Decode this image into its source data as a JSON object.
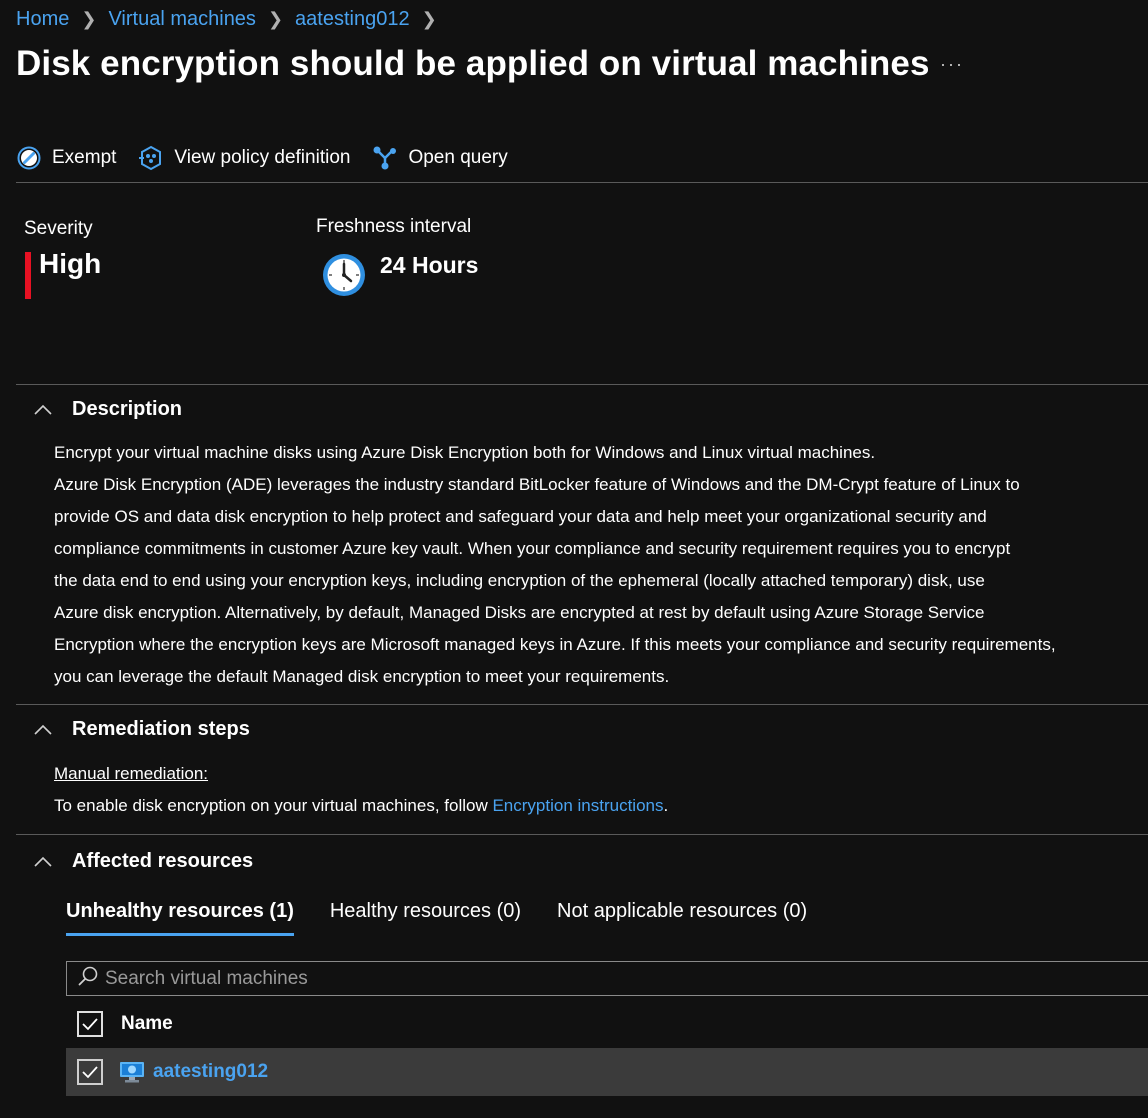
{
  "breadcrumb": {
    "items": [
      "Home",
      "Virtual machines",
      "aatesting012"
    ]
  },
  "page": {
    "title": "Disk encryption should be applied on virtual machines",
    "more_glyph": "···"
  },
  "toolbar": {
    "exempt": "Exempt",
    "view_policy": "View policy definition",
    "open_query": "Open query"
  },
  "summary": {
    "severity_label": "Severity",
    "severity_value": "High",
    "severity_color": "#e81123",
    "freshness_label": "Freshness interval",
    "freshness_value": "24 Hours"
  },
  "description": {
    "heading": "Description",
    "lines": [
      "Encrypt your virtual machine disks using Azure Disk Encryption both for Windows and Linux virtual machines.",
      "Azure Disk Encryption (ADE) leverages the industry standard BitLocker feature of Windows and the DM-Crypt feature of Linux to",
      "provide OS and data disk encryption to help protect and safeguard your data and help meet your organizational security and",
      "compliance commitments in customer Azure key vault. When your compliance and security requirement requires you to encrypt",
      "the data end to end using your encryption keys, including encryption of the ephemeral (locally attached temporary) disk, use",
      "Azure disk encryption. Alternatively, by default, Managed Disks are encrypted at rest by default using Azure Storage Service",
      "Encryption where the encryption keys are Microsoft managed keys in Azure. If this meets your compliance and security requirements,",
      "you can leverage the default Managed disk encryption to meet your requirements."
    ]
  },
  "remediation": {
    "heading": "Remediation steps",
    "manual_label": "Manual remediation:",
    "text_prefix": "To enable disk encryption on your virtual machines, follow ",
    "link_text": "Encryption instructions",
    "text_suffix": "."
  },
  "affected": {
    "heading": "Affected resources",
    "tabs": [
      "Unhealthy resources (1)",
      "Healthy resources (0)",
      "Not applicable resources (0)"
    ],
    "search_placeholder": "Search virtual machines",
    "column_name": "Name",
    "rows": [
      {
        "name": "aatesting012",
        "checked": true
      }
    ]
  },
  "colors": {
    "accent": "#4aa3f0",
    "background": "#111111",
    "row_selected": "#3b3b3b"
  }
}
